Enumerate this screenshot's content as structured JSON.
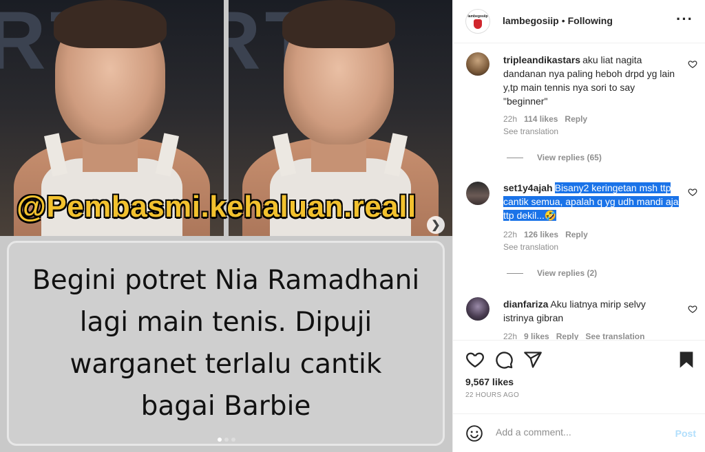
{
  "media": {
    "watermark": "@Pembasmi.kehaluan.reall",
    "caption_lines": "Begini potret Nia Ramadhani\nlagi main tenis. Dipuji\nwarganet terlalu cantik\nbagai Barbie",
    "carousel": {
      "total": 3,
      "active": 1
    },
    "next_icon": "chevron-right-icon"
  },
  "header": {
    "username": "lambegosiip",
    "separator": "•",
    "follow_status": "Following",
    "more_icon": "more-horizontal-icon"
  },
  "comments": [
    {
      "username": "tripleandikastars",
      "text": "aku liat nagita dandanan nya paling heboh drpd yg lain y,tp main tennis nya sori to say \"beginner\"",
      "highlighted": false,
      "time": "22h",
      "likes": "114 likes",
      "reply": "Reply",
      "translation": "See translation",
      "view_replies": "View replies (65)"
    },
    {
      "username": "set1y4ajah",
      "text": "Bisany2 keringetan msh ttp cantik semua, apalah q yg udh mandi aja ttp dekil...🤣",
      "highlighted": true,
      "time": "22h",
      "likes": "126 likes",
      "reply": "Reply",
      "translation": "See translation",
      "view_replies": "View replies (2)"
    },
    {
      "username": "dianfariza",
      "text": "Aku liatnya mirip selvy istrinya gibran",
      "highlighted": false,
      "time": "22h",
      "likes": "9 likes",
      "reply": "Reply",
      "translation": "See translation"
    }
  ],
  "actions": {
    "icons": [
      "heart-icon",
      "comment-icon",
      "share-icon",
      "bookmark-icon"
    ],
    "likes": "9,567 likes",
    "time_ago": "22 HOURS AGO"
  },
  "comment_box": {
    "placeholder": "Add a comment...",
    "post_label": "Post"
  },
  "colors": {
    "selection": "#1a73e8",
    "post_disabled": "#b2dffc",
    "watermark": "#f2c12e"
  }
}
